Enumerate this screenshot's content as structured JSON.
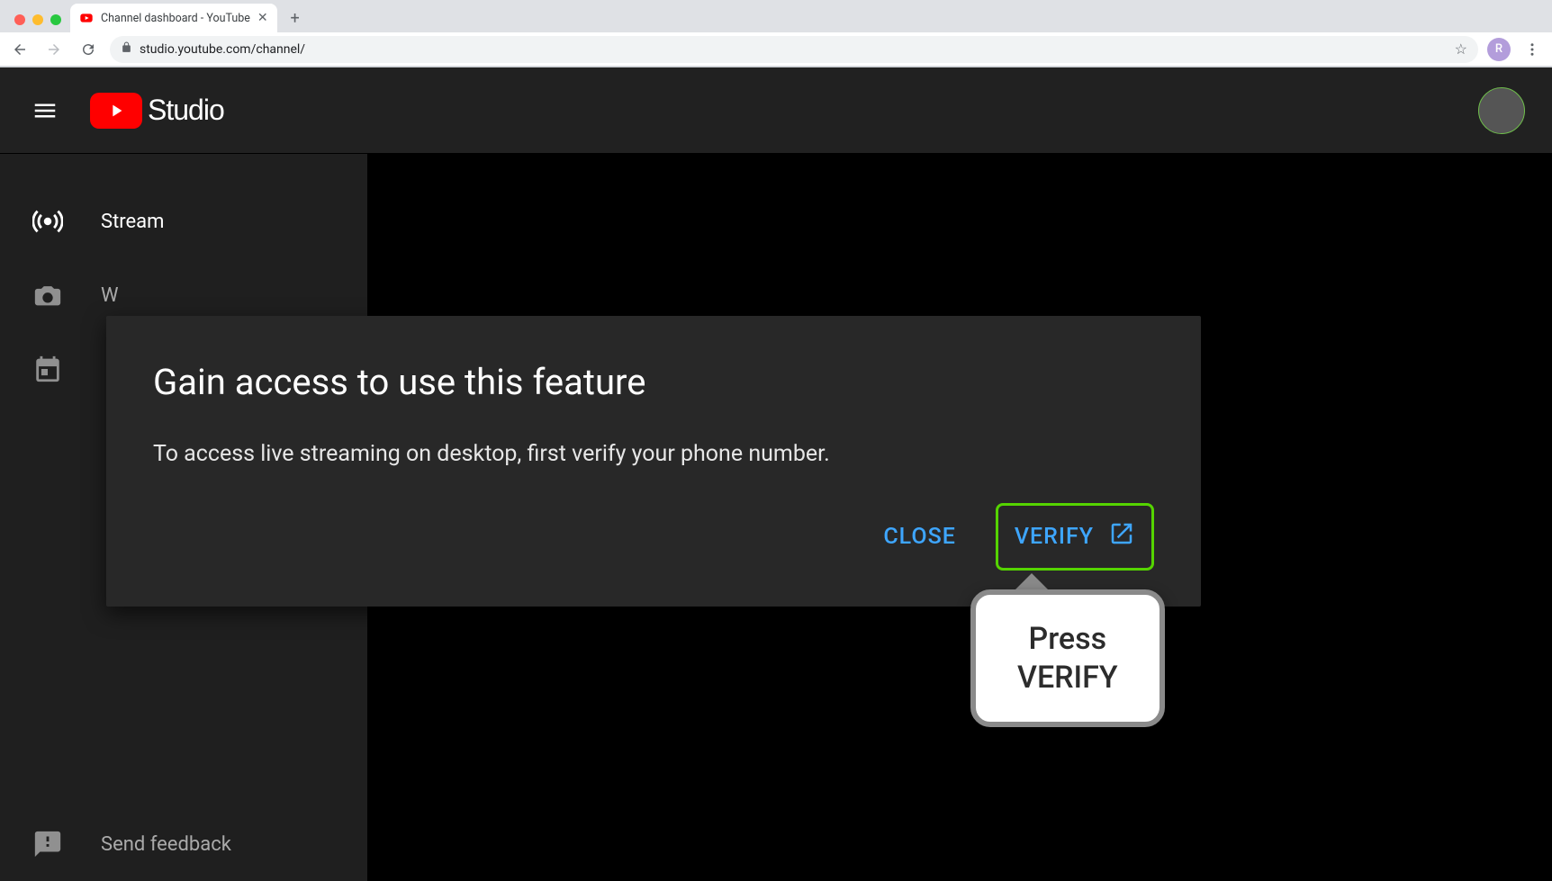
{
  "browser": {
    "tab_title": "Channel dashboard - YouTube",
    "url": "studio.youtube.com/channel/",
    "profile_letter": "R"
  },
  "header": {
    "studio_label": "Studio"
  },
  "sidebar": {
    "items": [
      {
        "label": "Stream"
      },
      {
        "label": "W"
      },
      {
        "label": ""
      }
    ],
    "feedback_label": "Send feedback"
  },
  "modal": {
    "title": "Gain access to use this feature",
    "body": "To access live streaming on desktop, first verify your phone number.",
    "close_label": "CLOSE",
    "verify_label": "VERIFY"
  },
  "callout": {
    "line1": "Press",
    "line2": "VERIFY"
  }
}
